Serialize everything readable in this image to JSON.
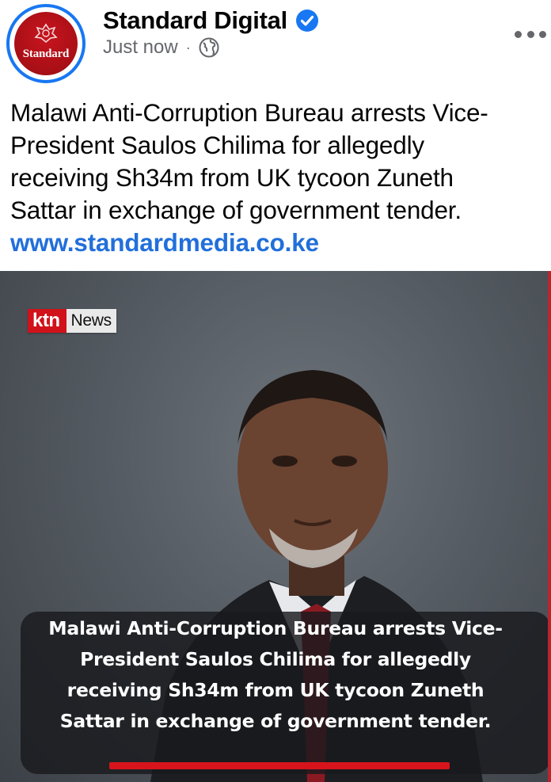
{
  "post": {
    "page_name": "Standard Digital",
    "avatar_text": "Standard",
    "timestamp": "Just now",
    "separator": "·",
    "audience_icon": "globe-icon",
    "verified_icon": "verified-badge-icon",
    "more_icon": "more-options-icon",
    "text_lines": [
      "Malawi Anti-Corruption Bureau arrests Vice-",
      "President Saulos Chilima for allegedly",
      "receiving Sh34m from UK tycoon Zuneth",
      "Sattar in exchange of government tender."
    ],
    "link": "www.standardmedia.co.ke"
  },
  "photo": {
    "logo_ktn": "ktn",
    "logo_news": "News",
    "caption_lines": [
      "Malawi Anti-Corruption Bureau arrests Vice-",
      "President Saulos Chilima for allegedly",
      "receiving Sh34m from UK tycoon Zuneth",
      "Sattar in exchange of government tender."
    ]
  },
  "colors": {
    "verified_blue": "#1877f2",
    "link_blue": "#216fdb",
    "brand_red": "#c8141e",
    "meta_gray": "#65676b"
  }
}
